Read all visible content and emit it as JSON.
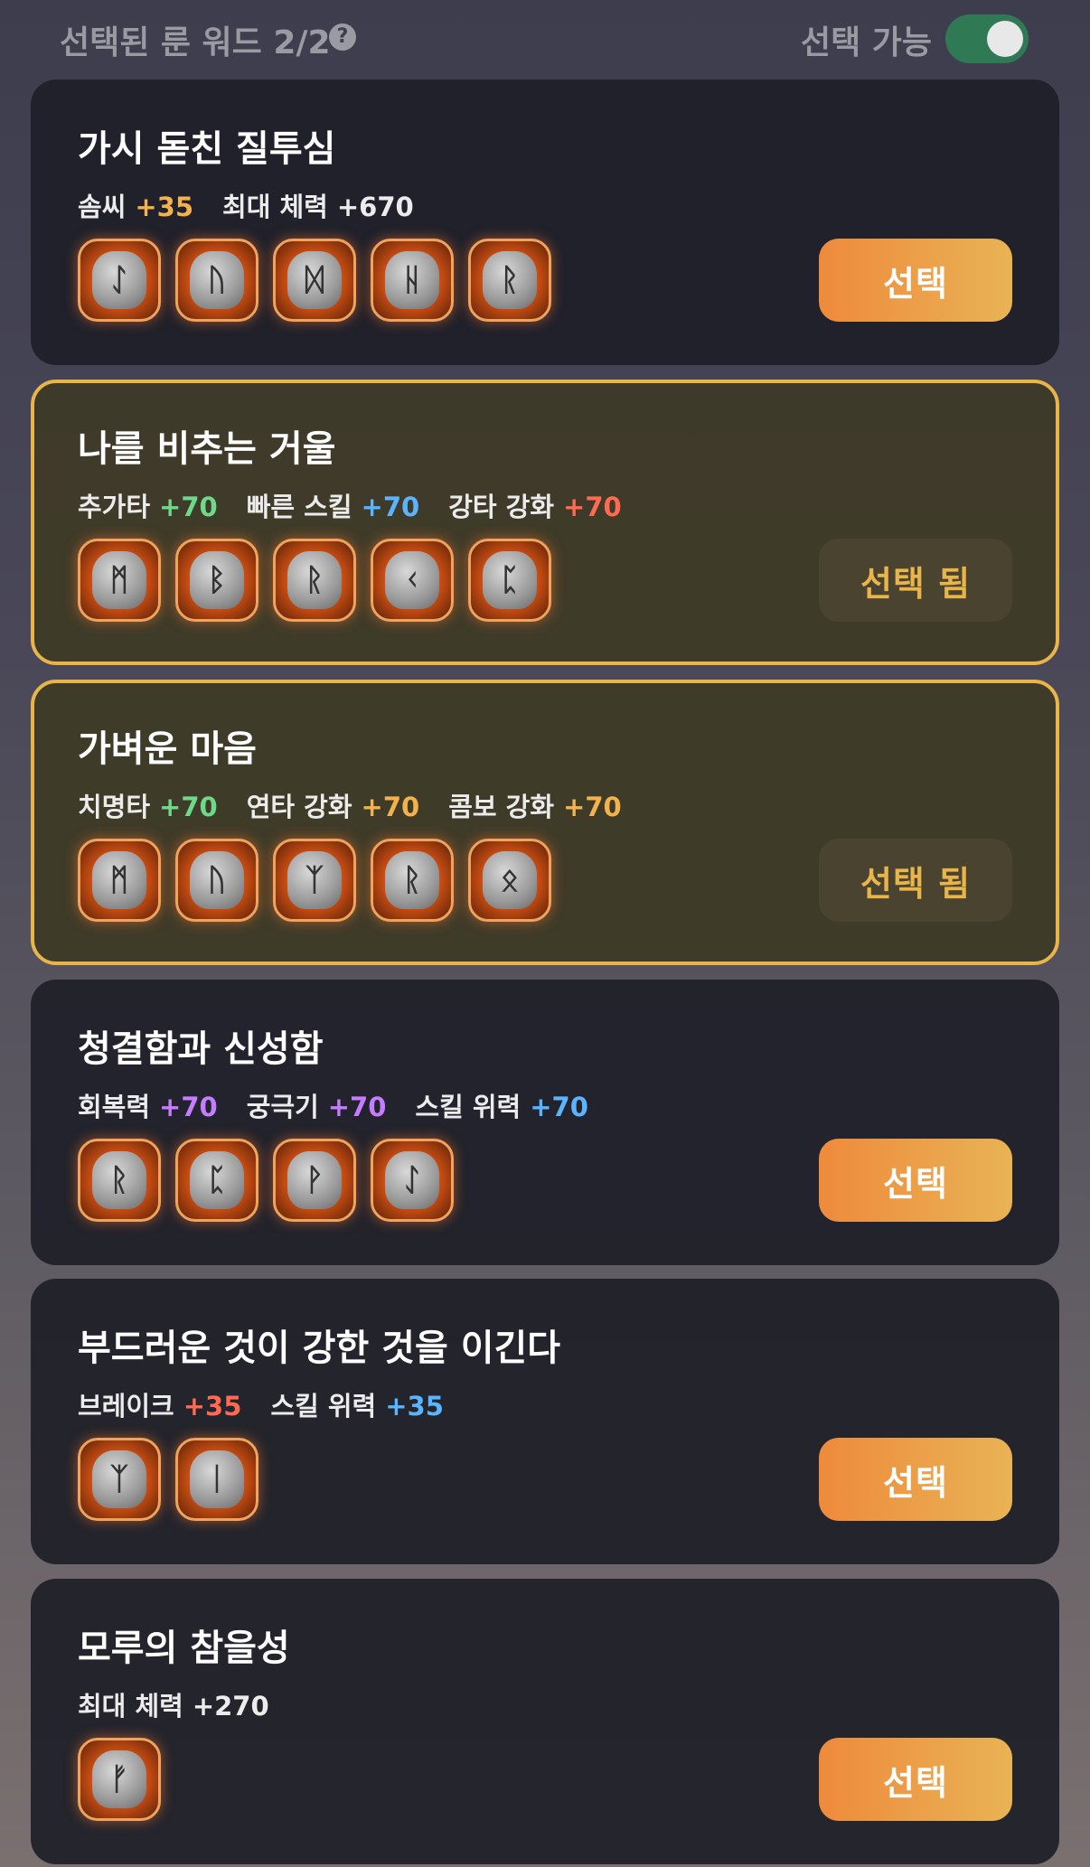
{
  "header": {
    "selected_label": "선택된 룬 워드 2/2",
    "help_icon": "?",
    "available_label": "선택 가능",
    "toggle_on": true
  },
  "colors": {
    "accent_orange": "#f0a040",
    "green": "#6fd98a",
    "blue": "#5ab4ff",
    "red": "#ff6a50",
    "purple": "#c57cff",
    "selected_border": "#e8b54a"
  },
  "cards": [
    {
      "title": "가시 돋친 질투심",
      "stats": [
        {
          "name": "솜씨",
          "value": "+35",
          "color": "#f3b24c"
        },
        {
          "name": "최대 체력",
          "value": "+670",
          "color": "#ececec"
        }
      ],
      "runes": [
        "ᛇ",
        "ᚢ",
        "ᛞ",
        "ᚺ",
        "ᚱ"
      ],
      "button": "선택",
      "selected": false
    },
    {
      "title": "나를 비추는 거울",
      "stats": [
        {
          "name": "추가타",
          "value": "+70",
          "color": "#6fd98a"
        },
        {
          "name": "빠른 스킬",
          "value": "+70",
          "color": "#5ab4ff"
        },
        {
          "name": "강타 강화",
          "value": "+70",
          "color": "#ff6a50"
        }
      ],
      "runes": [
        "ᛗ",
        "ᛒ",
        "ᚱ",
        "ᚲ",
        "ᛈ"
      ],
      "button": "선택 됨",
      "selected": true
    },
    {
      "title": "가벼운 마음",
      "stats": [
        {
          "name": "치명타",
          "value": "+70",
          "color": "#6fd98a"
        },
        {
          "name": "연타 강화",
          "value": "+70",
          "color": "#f3b24c"
        },
        {
          "name": "콤보 강화",
          "value": "+70",
          "color": "#f3b24c"
        }
      ],
      "runes": [
        "ᛗ",
        "ᚢ",
        "ᛉ",
        "ᚱ",
        "ᛟ"
      ],
      "button": "선택 됨",
      "selected": true
    },
    {
      "title": "청결함과 신성함",
      "stats": [
        {
          "name": "회복력",
          "value": "+70",
          "color": "#c57cff"
        },
        {
          "name": "궁극기",
          "value": "+70",
          "color": "#c57cff"
        },
        {
          "name": "스킬 위력",
          "value": "+70",
          "color": "#5ab4ff"
        }
      ],
      "runes": [
        "ᚱ",
        "ᛈ",
        "ᚹ",
        "ᛇ"
      ],
      "button": "선택",
      "selected": false
    },
    {
      "title": "부드러운 것이 강한 것을 이긴다",
      "stats": [
        {
          "name": "브레이크",
          "value": "+35",
          "color": "#ff6a50"
        },
        {
          "name": "스킬 위력",
          "value": "+35",
          "color": "#5ab4ff"
        }
      ],
      "runes": [
        "ᛉ",
        "ᛁ"
      ],
      "button": "선택",
      "selected": false
    },
    {
      "title": "모루의 참을성",
      "stats": [
        {
          "name": "최대 체력",
          "value": "+270",
          "color": "#ececec"
        }
      ],
      "runes": [
        "ᚠ"
      ],
      "button": "선택",
      "selected": false
    }
  ]
}
